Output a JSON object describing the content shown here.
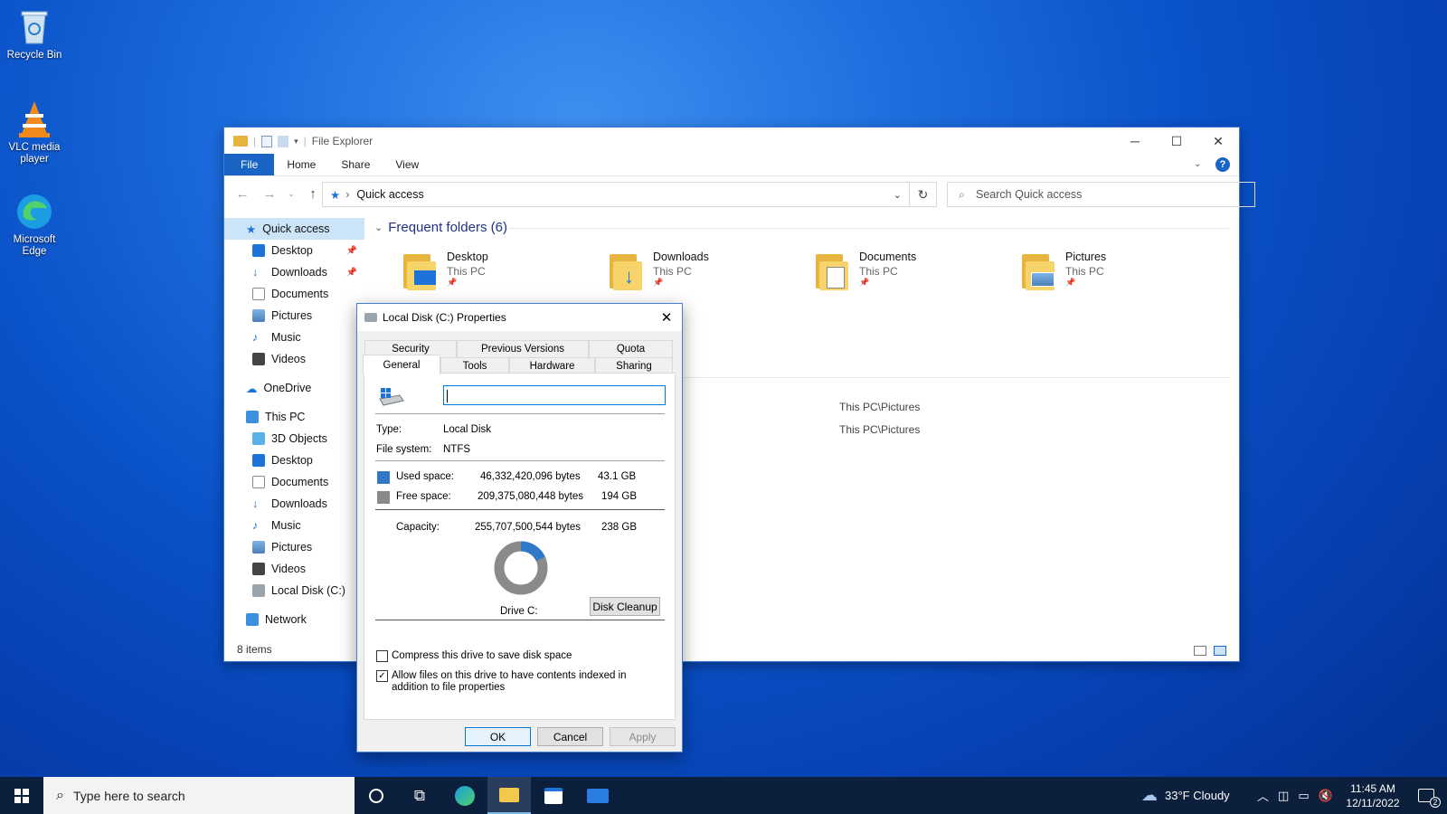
{
  "desktop": {
    "icons": [
      {
        "label": "Recycle Bin"
      },
      {
        "label": "VLC media player"
      },
      {
        "label": "Microsoft Edge"
      }
    ]
  },
  "explorer": {
    "title": "File Explorer",
    "ribbon_tabs": [
      "File",
      "Home",
      "Share",
      "View"
    ],
    "address": "Quick access",
    "search_placeholder": "Search Quick access",
    "sidebar": {
      "quick_access": "Quick access",
      "quick_items": [
        "Desktop",
        "Downloads",
        "Documents",
        "Pictures",
        "Music",
        "Videos"
      ],
      "onedrive": "OneDrive",
      "this_pc": "This PC",
      "pc_items": [
        "3D Objects",
        "Desktop",
        "Documents",
        "Downloads",
        "Music",
        "Pictures",
        "Videos",
        "Local Disk (C:)"
      ],
      "network": "Network"
    },
    "group_header": "Frequent folders (6)",
    "folders": [
      {
        "name": "Desktop",
        "location": "This PC"
      },
      {
        "name": "Downloads",
        "location": "This PC"
      },
      {
        "name": "Documents",
        "location": "This PC"
      },
      {
        "name": "Pictures",
        "location": "This PC"
      }
    ],
    "recent_paths": [
      "This PC\\Pictures",
      "This PC\\Pictures"
    ],
    "status": "8 items"
  },
  "dialog": {
    "title": "Local Disk (C:) Properties",
    "tabs_back": [
      "Security",
      "Previous Versions",
      "Quota"
    ],
    "tabs_front": [
      "General",
      "Tools",
      "Hardware",
      "Sharing"
    ],
    "name_value": "",
    "type_label": "Type:",
    "type_value": "Local Disk",
    "fs_label": "File system:",
    "fs_value": "NTFS",
    "used_label": "Used space:",
    "used_bytes": "46,332,420,096 bytes",
    "used_gb": "43.1 GB",
    "free_label": "Free space:",
    "free_bytes": "209,375,080,448 bytes",
    "free_gb": "194 GB",
    "capacity_label": "Capacity:",
    "capacity_bytes": "255,707,500,544 bytes",
    "capacity_gb": "238 GB",
    "used_fraction": 0.181,
    "drive_label": "Drive C:",
    "cleanup": "Disk Cleanup",
    "compress": "Compress this drive to save disk space",
    "compress_checked": false,
    "index": "Allow files on this drive to have contents indexed in addition to file properties",
    "index_checked": true,
    "ok": "OK",
    "cancel": "Cancel",
    "apply": "Apply",
    "used_color": "#2f79c8",
    "free_color": "#8a8a8a"
  },
  "taskbar": {
    "search_placeholder": "Type here to search",
    "weather": "33°F  Cloudy",
    "time": "11:45 AM",
    "date": "12/11/2022",
    "notifications": "2"
  }
}
